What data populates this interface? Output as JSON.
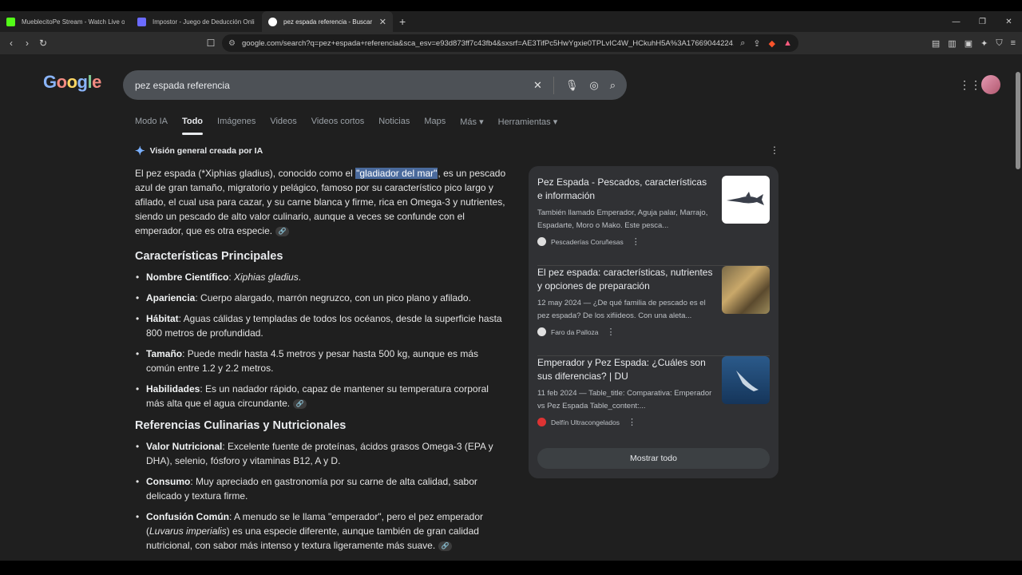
{
  "browser": {
    "tabs": [
      {
        "title": "MueblecitoPe Stream - Watch Live o",
        "active": false,
        "favicon_color": "#53fc18"
      },
      {
        "title": "Impostor - Juego de Deducción Onli",
        "active": false,
        "favicon_color": "#6b6bff"
      },
      {
        "title": "pez espada referencia - Buscar c",
        "active": true,
        "favicon_color": "#ffffff"
      }
    ],
    "url": "google.com/search?q=pez+espada+referencia&sca_esv=e93d873ff7c43fb4&sxsrf=AE3TifPc5HwYgxie0TPLvIC4W_HCkuhH5A%3A17669044224..."
  },
  "search": {
    "logo": "Google",
    "query": "pez espada referencia",
    "tabs": [
      "Modo IA",
      "Todo",
      "Imágenes",
      "Videos",
      "Videos cortos",
      "Noticias",
      "Maps",
      "Más ▾",
      "Herramientas ▾"
    ],
    "selected_tab": "Todo"
  },
  "ai_overview": {
    "heading": "Visión general creada por IA",
    "intro_before": "El pez espada (*Xiphias gladius), conocido como el ",
    "intro_highlight": "\"gladiador del mar\"",
    "intro_after": ", es un pescado azul de gran tamaño, migratorio y pelágico, famoso por su característico pico largo y afilado, el cual usa para cazar, y su carne blanca y firme, rica en Omega-3 y nutrientes, siendo un pescado de alto valor culinario, aunque a veces se confunde con el emperador, que es otra especie.",
    "section1_title": "Características Principales",
    "section1_items": [
      {
        "label": "Nombre Científico",
        "text": ": ",
        "italic": "Xiphias gladius",
        "after": "."
      },
      {
        "label": "Apariencia",
        "text": ": Cuerpo alargado, marrón negruzco, con un pico plano y afilado.",
        "italic": "",
        "after": ""
      },
      {
        "label": "Hábitat",
        "text": ": Aguas cálidas y templadas de todos los océanos, desde la superficie hasta 800 metros de profundidad.",
        "italic": "",
        "after": ""
      },
      {
        "label": "Tamaño",
        "text": ": Puede medir hasta 4.5 metros y pesar hasta 500 kg, aunque es más común entre 1.2 y 2.2 metros.",
        "italic": "",
        "after": ""
      },
      {
        "label": "Habilidades",
        "text": ": Es un nadador rápido, capaz de mantener su temperatura corporal más alta que el agua circundante.",
        "italic": "",
        "after": ""
      }
    ],
    "section2_title": "Referencias Culinarias y Nutricionales",
    "section2_items": [
      {
        "label": "Valor Nutricional",
        "text": ": Excelente fuente de proteínas, ácidos grasos Omega-3 (EPA y DHA), selenio, fósforo y vitaminas B12, A y D."
      },
      {
        "label": "Consumo",
        "text": ": Muy apreciado en gastronomía por su carne de alta calidad, sabor delicado y textura firme."
      },
      {
        "label": "Confusión Común",
        "text_before": ": A menudo se le llama \"emperador\", pero el pez emperador (",
        "italic": "Luvarus imperialis",
        "text_after": ") es una especie diferente, aunque también de gran calidad nutricional, con sabor más intenso y textura ligeramente más suave."
      }
    ]
  },
  "sources": [
    {
      "title": "Pez Espada - Pescados, características e información",
      "snippet": "También llamado Emperador, Aguja palar, Marrajo, Espadarte, Moro o Mako. Este pesca...",
      "site": "Pescaderías Coruñesas"
    },
    {
      "title": "El pez espada: características, nutrientes y opciones de preparación",
      "snippet": "12 may 2024 — ¿De qué familia de pescado es el pez espada? De los xifiideos. Con una aleta...",
      "site": "Faro da Palloza"
    },
    {
      "title": "Emperador y Pez Espada: ¿Cuáles son sus diferencias? | DU",
      "snippet": "11 feb 2024 — Table_title: Comparativa: Emperador vs Pez Espada Table_content:...",
      "site": "Delfín Ultracongelados"
    }
  ],
  "show_all": "Mostrar todo"
}
